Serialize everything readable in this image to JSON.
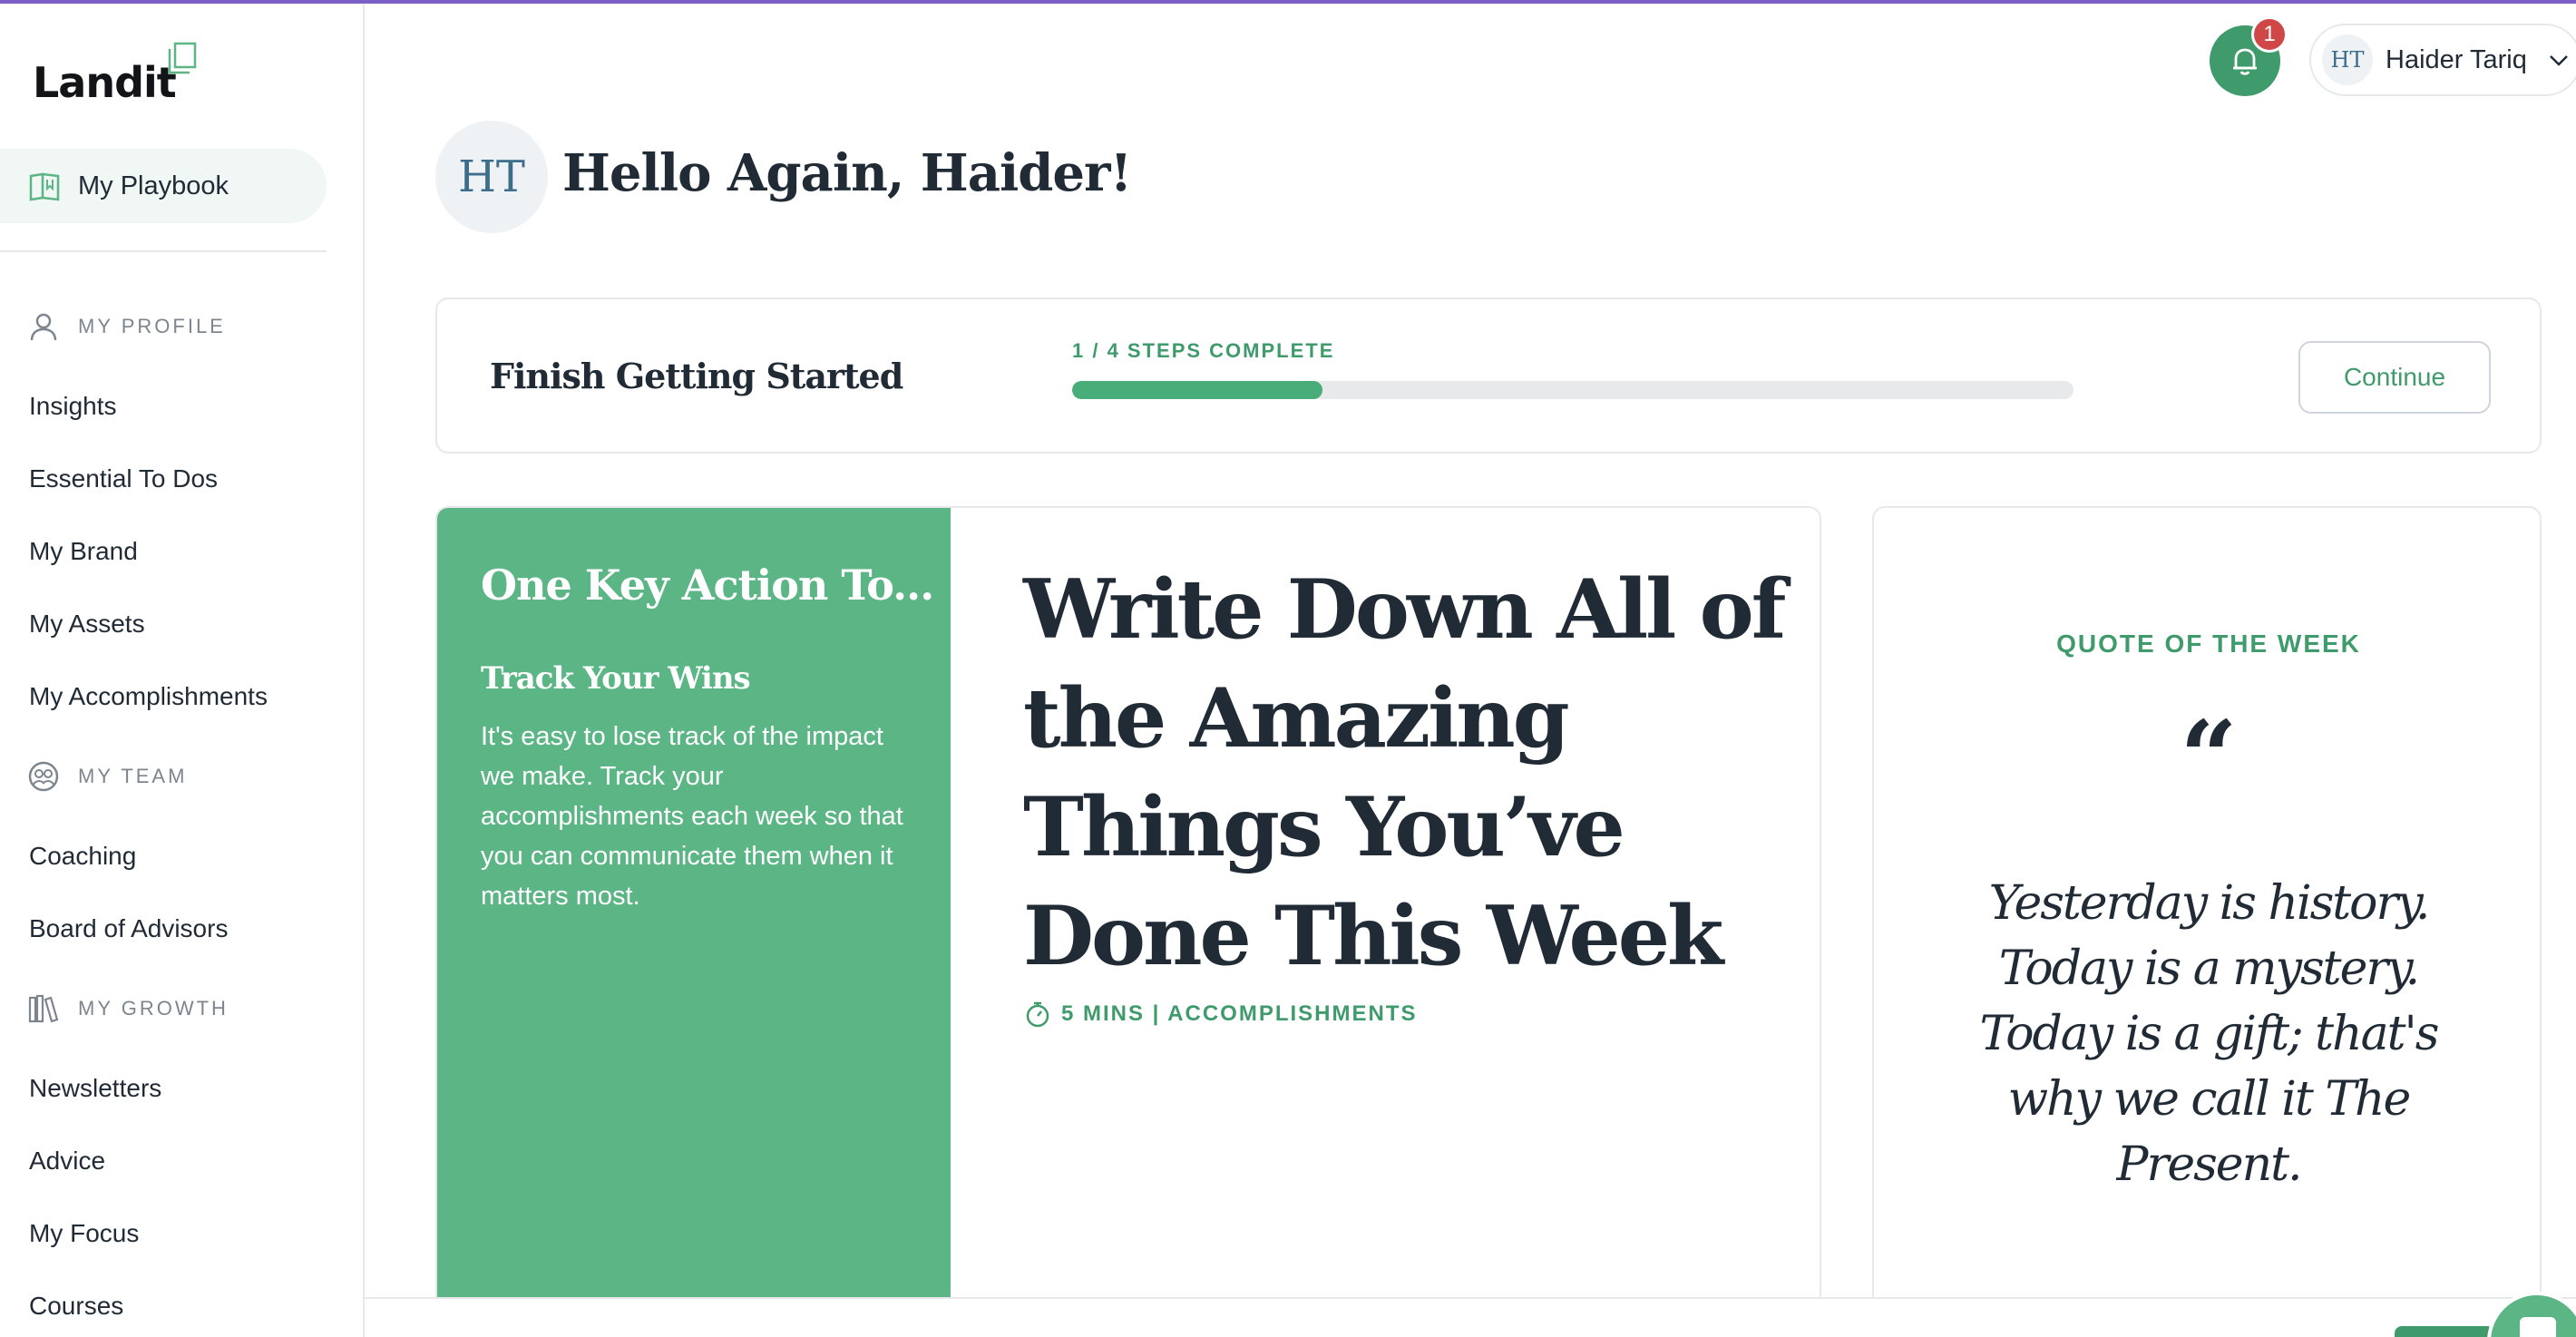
{
  "brand": {
    "name": "Landit",
    "accent": "#3f9b6b",
    "panel_green": "#5bb585",
    "top_line": "#7b5fc7"
  },
  "sidebar": {
    "playbook_label": "My Playbook",
    "sections": [
      {
        "label": "MY PROFILE",
        "icon": "person-icon",
        "items": [
          "Insights",
          "Essential To Dos",
          "My Brand",
          "My Assets",
          "My Accomplishments"
        ]
      },
      {
        "label": "MY TEAM",
        "icon": "team-icon",
        "items": [
          "Coaching",
          "Board of Advisors"
        ]
      },
      {
        "label": "MY GROWTH",
        "icon": "books-icon",
        "items": [
          "Newsletters",
          "Advice",
          "My Focus",
          "Courses"
        ]
      }
    ]
  },
  "header": {
    "notification_count": "1",
    "user_initials": "HT",
    "user_name": "Haider Tariq"
  },
  "greeting": {
    "initials": "HT",
    "text": "Hello Again, Haider!"
  },
  "getting_started": {
    "title": "Finish Getting Started",
    "steps_text": "1 / 4 STEPS COMPLETE",
    "progress": 0.25,
    "continue_label": "Continue"
  },
  "key_action": {
    "panel_title": "One Key Action To...",
    "subtitle": "Track Your Wins",
    "body": "It's easy to lose track of the impact we make. Track your accomplishments each week so that you can communicate them when it matters most.",
    "headline": "Write Down All of the Amazing Things You’ve Done This Week",
    "meta": "5 MINS | ACCOMPLISHMENTS"
  },
  "quote": {
    "label": "QUOTE OF THE WEEK",
    "mark": "“",
    "text": "Yesterday is history. Today is a mystery. Today is a gift; that's why we call it The Present."
  }
}
